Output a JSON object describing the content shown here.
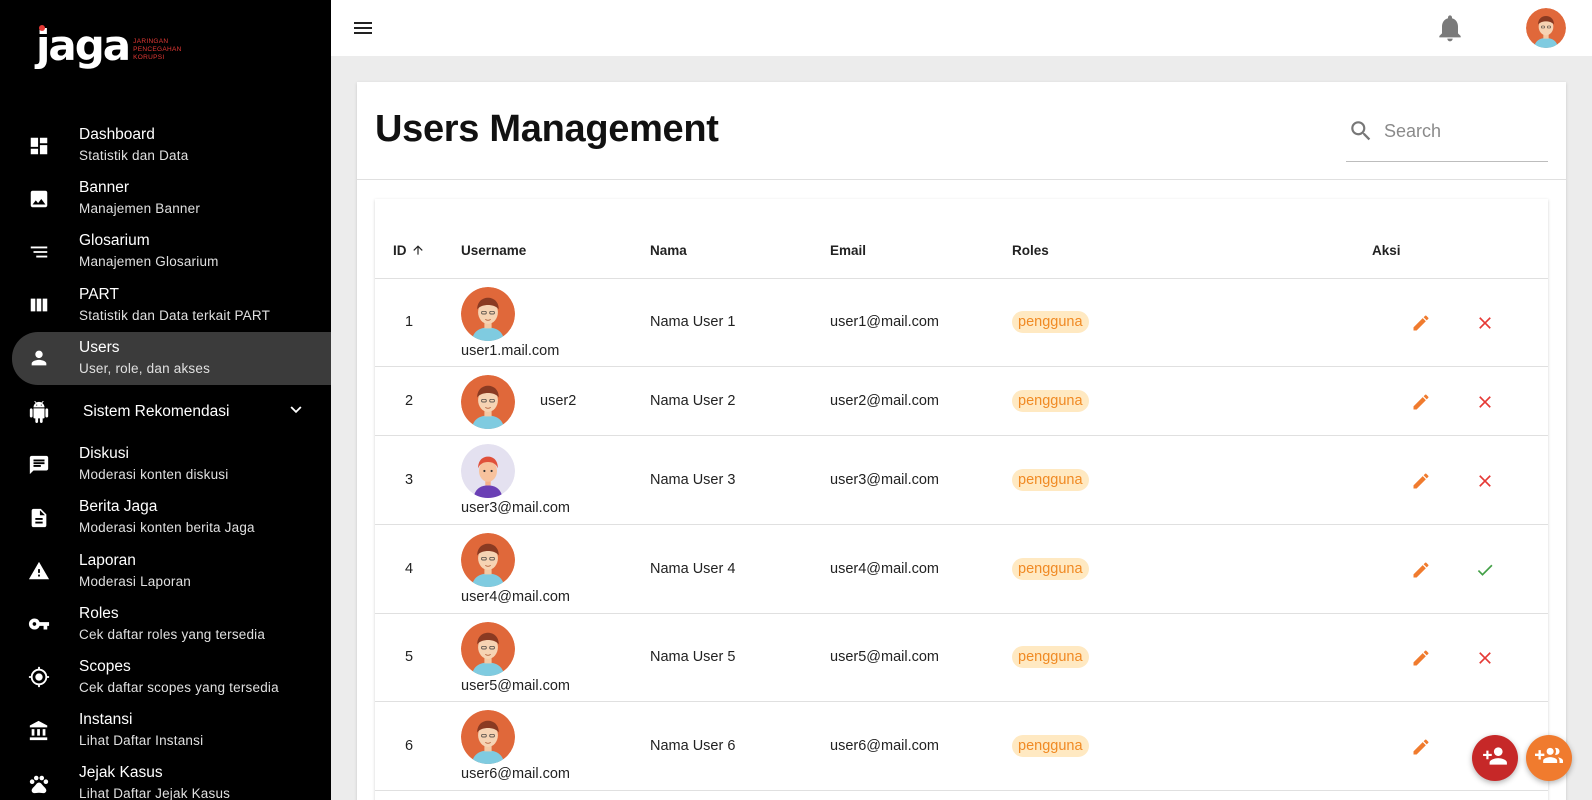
{
  "brand": {
    "word": "jaga",
    "sub_lines": [
      "JARINGAN",
      "PENCEGAHAN",
      "KORUPSI"
    ],
    "accent_color": "#e53935"
  },
  "sidebar": {
    "items": [
      {
        "icon": "dashboard-icon",
        "title": "Dashboard",
        "sub": "Statistik dan Data"
      },
      {
        "icon": "image-icon",
        "title": "Banner",
        "sub": "Manajemen Banner"
      },
      {
        "icon": "list-icon",
        "title": "Glosarium",
        "sub": "Manajemen Glosarium"
      },
      {
        "icon": "columns-icon",
        "title": "PART",
        "sub": "Statistik dan Data terkait PART"
      },
      {
        "icon": "person-icon",
        "title": "Users",
        "sub": "User, role, dan akses",
        "active": true
      },
      {
        "icon": "android-icon",
        "title": "Sistem Rekomendasi",
        "sub": ""
      },
      {
        "icon": "chat-icon",
        "title": "Diskusi",
        "sub": "Moderasi konten diskusi"
      },
      {
        "icon": "document-icon",
        "title": "Berita Jaga",
        "sub": "Moderasi konten berita Jaga"
      },
      {
        "icon": "warning-icon",
        "title": "Laporan",
        "sub": "Moderasi Laporan"
      },
      {
        "icon": "key-icon",
        "title": "Roles",
        "sub": "Cek daftar roles yang tersedia"
      },
      {
        "icon": "target-icon",
        "title": "Scopes",
        "sub": "Cek daftar scopes yang tersedia"
      },
      {
        "icon": "bank-icon",
        "title": "Instansi",
        "sub": "Lihat Daftar Instansi"
      },
      {
        "icon": "paw-icon",
        "title": "Jejak Kasus",
        "sub": "Lihat Daftar Jejak Kasus"
      }
    ]
  },
  "page": {
    "title": "Users Management",
    "search_placeholder": "Search"
  },
  "table": {
    "headers": {
      "id": "ID",
      "username": "Username",
      "nama": "Nama",
      "email": "Email",
      "roles": "Roles",
      "aksi": "Aksi"
    },
    "rows": [
      {
        "id": "1",
        "username": "user1.mail.com",
        "inline": false,
        "avatar": "orange",
        "nama": "Nama User 1",
        "email": "user1@mail.com",
        "role": "pengguna",
        "status": "x"
      },
      {
        "id": "2",
        "username": "user2",
        "inline": true,
        "avatar": "orange",
        "nama": "Nama User 2",
        "email": "user2@mail.com",
        "role": "pengguna",
        "status": "x"
      },
      {
        "id": "3",
        "username": "user3@mail.com",
        "inline": false,
        "avatar": "lavender",
        "nama": "Nama User 3",
        "email": "user3@mail.com",
        "role": "pengguna",
        "status": "x"
      },
      {
        "id": "4",
        "username": "user4@mail.com",
        "inline": false,
        "avatar": "orange",
        "nama": "Nama User 4",
        "email": "user4@mail.com",
        "role": "pengguna",
        "status": "check"
      },
      {
        "id": "5",
        "username": "user5@mail.com",
        "inline": false,
        "avatar": "orange",
        "nama": "Nama User 5",
        "email": "user5@mail.com",
        "role": "pengguna",
        "status": "x"
      },
      {
        "id": "6",
        "username": "user6@mail.com",
        "inline": false,
        "avatar": "orange",
        "nama": "Nama User 6",
        "email": "user6@mail.com",
        "role": "pengguna",
        "status": "x"
      }
    ]
  },
  "colors": {
    "edit": "#f07b2e",
    "delete": "#e53935",
    "check": "#43a047",
    "badge_bg": "#ffe9c2",
    "badge_text": "#f08a24",
    "fab_add": "#c62828",
    "fab_group": "#f07b2e"
  }
}
